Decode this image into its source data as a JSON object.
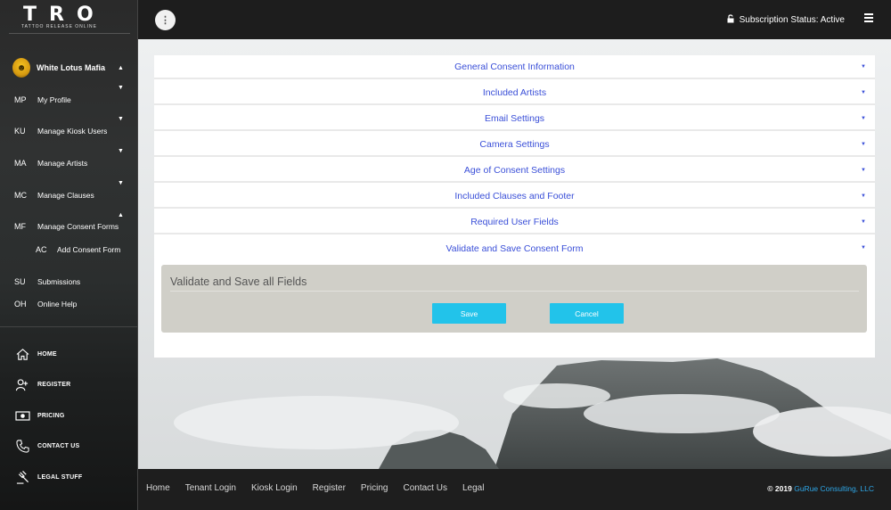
{
  "logo": {
    "main": "TRO",
    "sub": "TATTOO RELEASE ONLINE"
  },
  "sidebar": {
    "user": {
      "name": "White Lotus Mafia",
      "avatar_glyph": "☻"
    },
    "items": [
      {
        "abbr": "MP",
        "label": "My Profile"
      },
      {
        "abbr": "KU",
        "label": "Manage Kiosk Users"
      },
      {
        "abbr": "MA",
        "label": "Manage Artists"
      },
      {
        "abbr": "MC",
        "label": "Manage Clauses"
      },
      {
        "abbr": "MF",
        "label": "Manage Consent Forms"
      },
      {
        "abbr": "AC",
        "label": "Add Consent Form"
      },
      {
        "abbr": "SU",
        "label": "Submissions"
      },
      {
        "abbr": "OH",
        "label": "Online Help"
      }
    ],
    "links": [
      {
        "label": "HOME",
        "icon": "home-icon"
      },
      {
        "label": "REGISTER",
        "icon": "add-user-icon"
      },
      {
        "label": "PRICING",
        "icon": "money-icon"
      },
      {
        "label": "CONTACT US",
        "icon": "phone-icon"
      },
      {
        "label": "LEGAL STUFF",
        "icon": "gavel-icon"
      }
    ]
  },
  "topbar": {
    "menu_glyph": "⋮",
    "subscription_status": "Subscription Status: Active"
  },
  "accordion": [
    "General Consent Information",
    "Included Artists",
    "Email Settings",
    "Camera Settings",
    "Age of Consent Settings",
    "Included Clauses and Footer",
    "Required User Fields",
    "Validate and Save Consent Form"
  ],
  "validate": {
    "title": "Validate and Save all Fields",
    "save_label": "Save",
    "cancel_label": "Cancel"
  },
  "footer": {
    "links": [
      "Home",
      "Tenant Login",
      "Kiosk Login",
      "Register",
      "Pricing",
      "Contact Us",
      "Legal"
    ],
    "copyright_prefix": "© 2019",
    "copyright_brand": "GuRue Consulting, LLC"
  },
  "colors": {
    "accent_link": "#3a4fd8",
    "button": "#22c3ea",
    "brand": "#2ea6e6",
    "topbar": "#1d1d1d"
  }
}
